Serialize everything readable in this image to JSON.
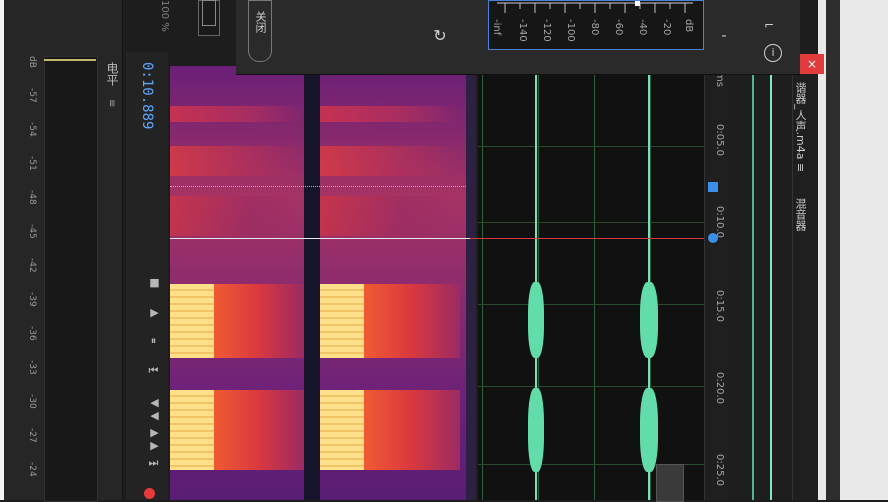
{
  "meter": {
    "unit": "dB",
    "ticks": [
      "-57",
      "-54",
      "-51",
      "-48",
      "-45",
      "-42",
      "-39",
      "-36",
      "-33",
      "-30",
      "-27",
      "-24"
    ],
    "label": "电平",
    "menu": "≡"
  },
  "transport": {
    "time": "0:10.889",
    "buttons": [
      "■",
      "▶",
      "⏸",
      "⏮",
      "◀◀",
      "▶▶",
      "⏭"
    ]
  },
  "top_panel": {
    "percent": "100 %",
    "close_label": "关闭",
    "reset_icon": "↻",
    "db_scale": [
      "-inf",
      "-140",
      "-120",
      "-100",
      "-80",
      "-60",
      "-40",
      "-20",
      "dB"
    ],
    "minus": "-",
    "info": "i",
    "close_x": "×"
  },
  "ruler": {
    "unit": "ms",
    "ticks": [
      "0:05.0",
      "0:10.0",
      "0:15.0",
      "0:20.0",
      "0:25.0"
    ]
  },
  "side": {
    "file_name": "谐器_人声.m4a",
    "menu": "≡",
    "mixer": "混音器"
  },
  "colors": {
    "accent": "#5da8ff",
    "waveform": "#62dca8",
    "playhead": "#d13b3b",
    "record": "#e83a3a"
  }
}
